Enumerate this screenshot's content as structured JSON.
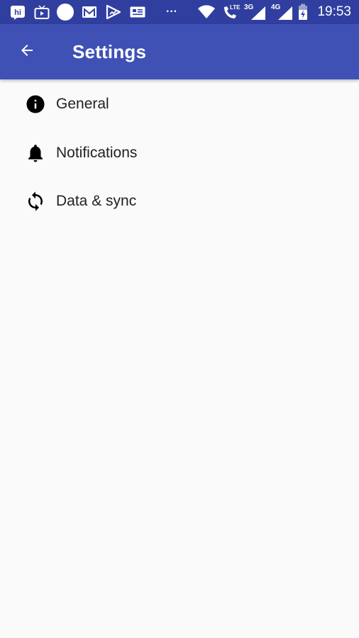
{
  "status_bar": {
    "time": "19:53",
    "notification_icons": [
      "hike-icon",
      "tv-icon",
      "circle-icon",
      "gmail-icon",
      "play-icon",
      "news-icon",
      "more-dots-icon"
    ],
    "more_dots": "···",
    "system_icons": [
      "wifi-icon",
      "call-lte-icon",
      "signal-3g-icon",
      "signal-4g-icon",
      "battery-charging-icon"
    ],
    "lte_label": "LTE",
    "net1_label": "3G",
    "net2_label": "4G",
    "hike_label": "hi"
  },
  "app_bar": {
    "title": "Settings",
    "back_icon": "arrow-back-icon"
  },
  "colors": {
    "primary": "#3f51b5",
    "primary_dark": "#303f9f",
    "background": "#fafafa"
  },
  "settings": {
    "items": [
      {
        "label": "General",
        "icon": "info-icon"
      },
      {
        "label": "Notifications",
        "icon": "bell-icon"
      },
      {
        "label": "Data & sync",
        "icon": "sync-icon"
      }
    ]
  }
}
